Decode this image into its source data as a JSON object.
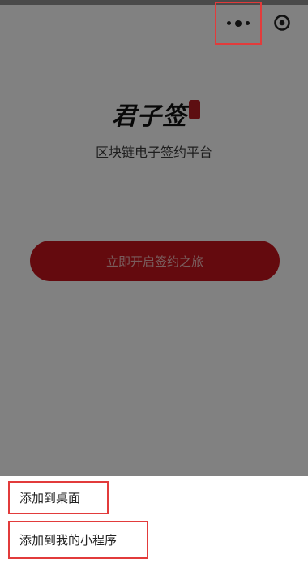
{
  "top_bar": {
    "more_icon": "more-dots-icon",
    "close_icon": "record-circle-icon"
  },
  "brand": {
    "logo_text": "君子签",
    "subtitle": "区块链电子签约平台"
  },
  "main": {
    "start_button_label": "立即开启签约之旅"
  },
  "sheet": {
    "items": [
      {
        "label": "添加到桌面"
      },
      {
        "label": "添加到我的小程序"
      }
    ]
  },
  "colors": {
    "accent": "#c0151c",
    "highlight_box": "#e23b3b"
  }
}
